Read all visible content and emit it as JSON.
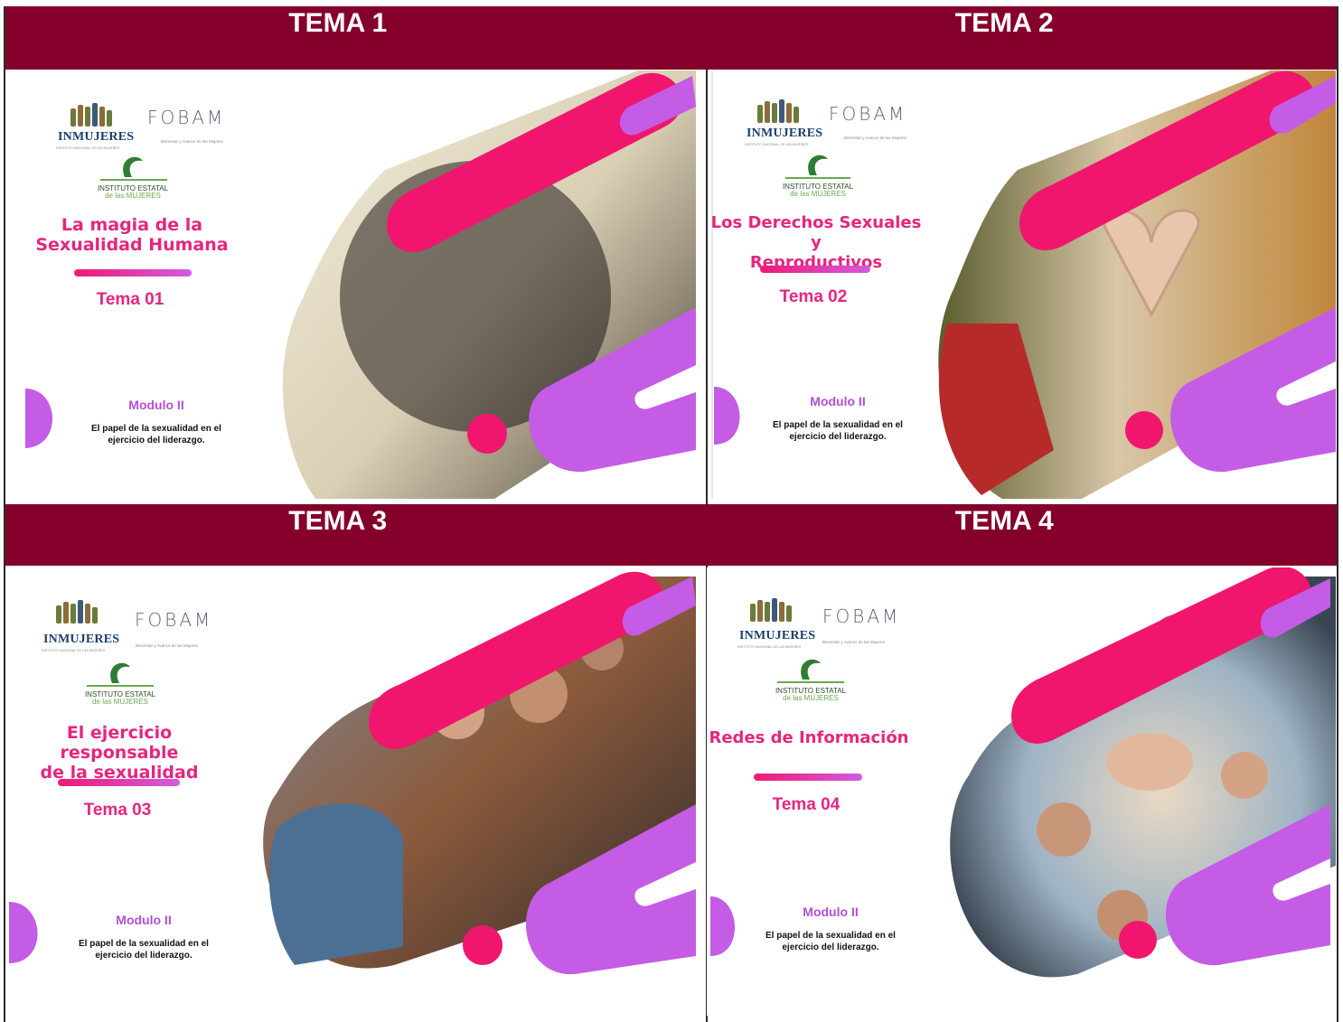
{
  "headers": [
    "TEMA 1",
    "TEMA 2",
    "TEMA 3",
    "TEMA 4"
  ],
  "common": {
    "inmujeres": "INMUJERES",
    "inmujeres_sub": "INSTITUTO NACIONAL DE LAS MUJERES",
    "fobam": "FOBAM",
    "fobam_sub": "Bienestar y Avance de las Mujeres",
    "iem_line1": "INSTITUTO ESTATAL",
    "iem_line2": "de las MUJERES",
    "modulo": "Modulo II",
    "modulo_desc_1": "El papel de la sexualidad en el",
    "modulo_desc_2": "ejercicio del liderazgo."
  },
  "slides": [
    {
      "title_1": "La magia de la",
      "title_2": "Sexualidad Humana",
      "tema": "Tema 01",
      "photo": "silhouette-portrait"
    },
    {
      "title_1": "Los Derechos Sexuales y",
      "title_2": "Reproductivos",
      "tema": "Tema 02",
      "photo": "heart-hands"
    },
    {
      "title_1": "El ejercicio responsable",
      "title_2": "de la sexualidad",
      "tema": "Tema 03",
      "photo": "students-classroom"
    },
    {
      "title_1": "Redes de Información",
      "title_2": "",
      "tema": "Tema 04",
      "photo": "team-hands-circle"
    }
  ],
  "colors": {
    "header_bg": "#84002a",
    "magenta": "#f0166d",
    "violet": "#c45ce6",
    "title": "#e6257f"
  }
}
